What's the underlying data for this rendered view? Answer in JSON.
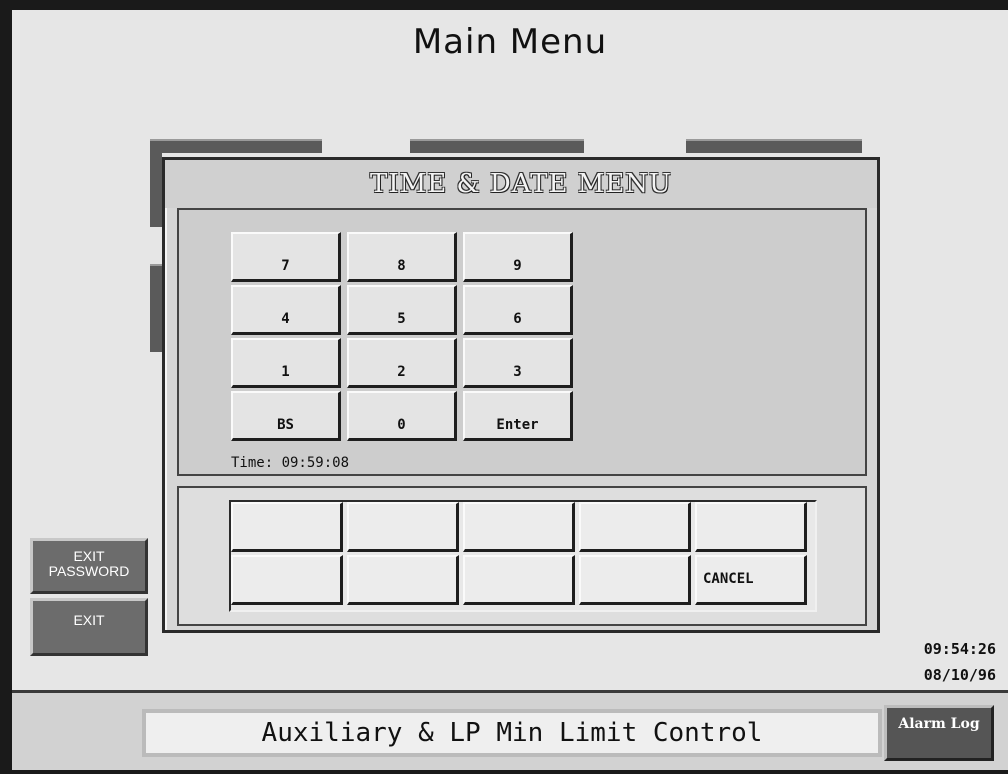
{
  "screen": {
    "title": "Main Menu"
  },
  "dialog": {
    "title": "TIME & DATE MENU",
    "keypad": [
      [
        "7",
        "8",
        "9"
      ],
      [
        "4",
        "5",
        "6"
      ],
      [
        "1",
        "2",
        "3"
      ],
      [
        "BS",
        "0",
        "Enter"
      ]
    ],
    "time_label": "Time: 09:59:08",
    "function_keys": {
      "row1": [
        "",
        "",
        "",
        "",
        ""
      ],
      "row2": [
        "",
        "",
        "",
        "",
        "CANCEL"
      ]
    }
  },
  "side_buttons": {
    "exit_password": "EXIT PASSWORD",
    "exit": "EXIT"
  },
  "clock": {
    "time": "09:54:26",
    "date": "08/10/96"
  },
  "footer": {
    "title": "Auxiliary & LP Min Limit Control",
    "alarm_log": "Alarm Log"
  }
}
